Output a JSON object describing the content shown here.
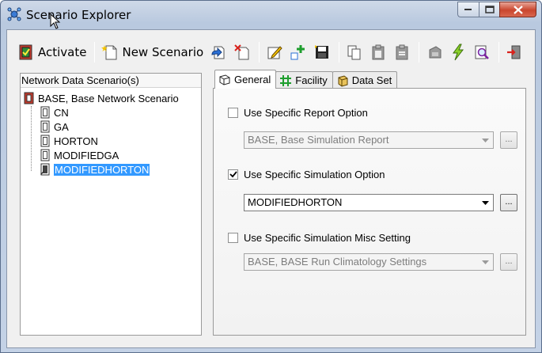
{
  "window": {
    "title": "Scenario Explorer",
    "icon": "network-explorer-icon"
  },
  "toolbar": {
    "activate_label": "Activate",
    "new_scenario_label": "New Scenario",
    "icons": [
      "activate-icon",
      "new-scenario-icon",
      "import-icon",
      "delete-icon",
      "edit-icon",
      "add-child-icon",
      "save-icon",
      "copy-icon",
      "paste-icon",
      "paste-special-icon",
      "clone-icon",
      "run-icon",
      "inspect-icon",
      "exit-icon"
    ]
  },
  "left_panel": {
    "header": "Network Data Scenario(s)",
    "root": "BASE, Base Network Scenario",
    "children": [
      "CN",
      "GA",
      "HORTON",
      "MODIFIEDGA",
      "MODIFIEDHORTON"
    ],
    "selected": "MODIFIEDHORTON"
  },
  "tabs": [
    {
      "label": "General",
      "active": true
    },
    {
      "label": "Facility",
      "active": false
    },
    {
      "label": "Data Set",
      "active": false
    }
  ],
  "general": {
    "report": {
      "label": "Use Specific Report Option",
      "checked": false,
      "value": "BASE, Base Simulation Report",
      "browse_label": "..."
    },
    "simulation": {
      "label": "Use Specific Simulation Option",
      "checked": true,
      "value": "MODIFIEDHORTON",
      "browse_label": "..."
    },
    "misc": {
      "label": "Use Specific Simulation Misc Setting",
      "checked": false,
      "value": "BASE, BASE Run Climatology Settings",
      "browse_label": "..."
    }
  },
  "colors": {
    "selection": "#3399ff",
    "close_button": "#c9452d"
  }
}
